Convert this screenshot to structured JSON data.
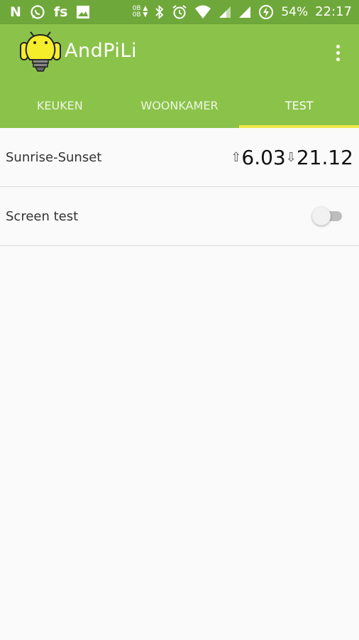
{
  "status_bar": {
    "notification_icons": [
      "n-icon",
      "whatsapp-icon",
      "fs-text",
      "image-icon"
    ],
    "fs_label": "fs",
    "data_arrows_top": "0B ▲",
    "data_arrows_bottom": "0B ▼",
    "battery_percent": "54%",
    "time": "22:17",
    "status_icons": [
      "bluetooth-icon",
      "alarm-icon",
      "wifi-icon",
      "signal-icon",
      "signal-icon",
      "battery-charging-icon"
    ]
  },
  "app": {
    "title": "AndPiLi",
    "logo_icon": "android-bulb-logo-icon",
    "menu_icon": "overflow-menu-icon",
    "colors": {
      "primary": "#8bc34a",
      "status_bar": "#6fa83a",
      "tab_indicator": "#f1e84a"
    }
  },
  "tabs": [
    {
      "label": "KEUKEN",
      "active": false
    },
    {
      "label": "WOONKAMER",
      "active": false
    },
    {
      "label": "TEST",
      "active": true
    }
  ],
  "items": [
    {
      "label": "Sunrise-Sunset",
      "sunrise_arrow": "⇧",
      "sunrise": "6.03",
      "sunset_arrow": "⇩",
      "sunset": "21.12"
    },
    {
      "label": "Screen test",
      "toggle_on": false
    }
  ]
}
